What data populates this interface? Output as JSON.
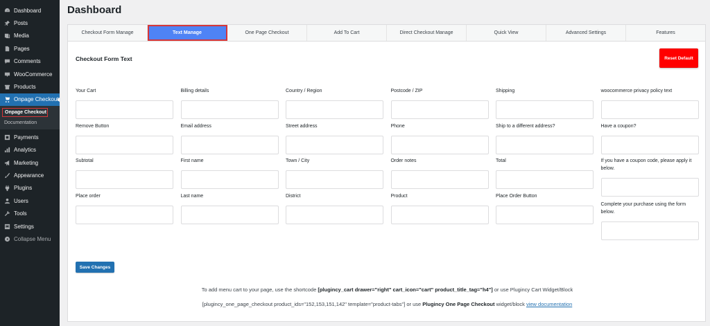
{
  "sidebar": {
    "items": [
      {
        "label": "Dashboard",
        "icon": "dashboard-icon"
      },
      {
        "label": "Posts",
        "icon": "pin-icon"
      },
      {
        "label": "Media",
        "icon": "media-icon"
      },
      {
        "label": "Pages",
        "icon": "page-icon"
      },
      {
        "label": "Comments",
        "icon": "comment-icon"
      },
      {
        "label": "WooCommerce",
        "icon": "woocommerce-icon"
      },
      {
        "label": "Products",
        "icon": "products-icon"
      },
      {
        "label": "Onpage Checkout",
        "icon": "cart-icon"
      }
    ],
    "submenu": [
      "Onpage Checkout",
      "Documentation"
    ],
    "items_after": [
      {
        "label": "Payments",
        "icon": "payments-icon"
      },
      {
        "label": "Analytics",
        "icon": "analytics-icon"
      },
      {
        "label": "Marketing",
        "icon": "megaphone-icon"
      },
      {
        "label": "Appearance",
        "icon": "brush-icon"
      },
      {
        "label": "Plugins",
        "icon": "plugin-icon"
      },
      {
        "label": "Users",
        "icon": "users-icon"
      },
      {
        "label": "Tools",
        "icon": "wrench-icon"
      },
      {
        "label": "Settings",
        "icon": "settings-icon"
      },
      {
        "label": "Collapse Menu",
        "icon": "collapse-icon"
      }
    ]
  },
  "page": {
    "title": "Dashboard"
  },
  "tabs": [
    "Checkout Form Manage",
    "Text Manage",
    "One Page Checkout",
    "Add To Cart",
    "Direct Checkout Manage",
    "Quick View",
    "Advanced Settings",
    "Features"
  ],
  "section": {
    "title": "Checkout Form Text",
    "reset_label": "Reset Default",
    "save_label": "Save Changes"
  },
  "columns": [
    [
      "Your Cart",
      "Remove Button",
      "Subtotal",
      "Place order"
    ],
    [
      "Billing details",
      "Email address",
      "First name",
      "Last name"
    ],
    [
      "Country / Region",
      "Street address",
      "Town / City",
      "District"
    ],
    [
      "Postcode / ZIP",
      "Phone",
      "Order notes",
      "Product"
    ],
    [
      "Shipping",
      "Ship to a different address?",
      "Total",
      "Place Order Button"
    ],
    [
      "woocommerce privacy policy text",
      "Have a coupon?",
      "If you have a coupon code, please apply it below.",
      "Complete your purchase using the form below."
    ]
  ],
  "footer": {
    "line1_pre": "To add menu cart to your page, use the shortcode ",
    "line1_code": "[plugincy_cart drawer=\"right\" cart_icon=\"cart\" product_title_tag=\"h4\"]",
    "line1_post": " or use Plugincy Cart Widget/Block",
    "line2_pre": "[plugincy_one_page_checkout product_ids=\"152,153,151,142\" template=\"product-tabs\"] or use ",
    "line2_bold": "Plugincy One Page Checkout",
    "line2_mid": " widget/block ",
    "line2_link": "view documentation"
  }
}
